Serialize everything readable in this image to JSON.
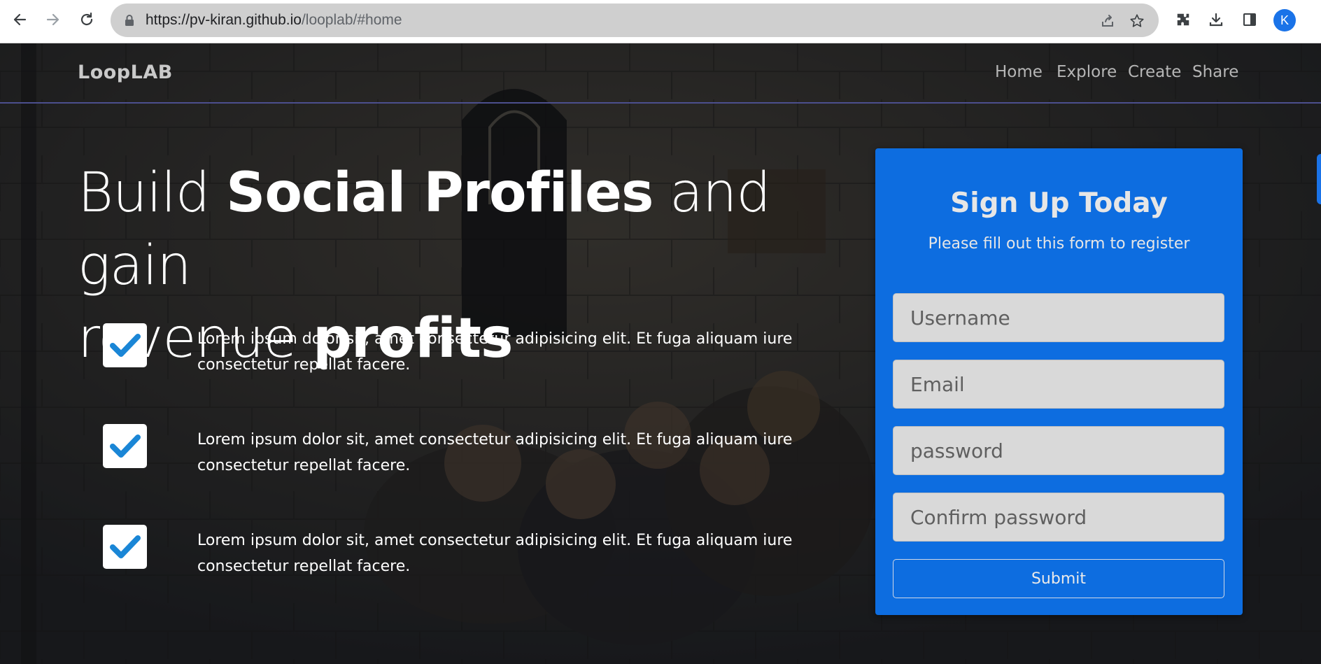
{
  "browser": {
    "url_host": "https://pv-kiran.github.io",
    "url_path": "/looplab/#home",
    "profile_initial": "K"
  },
  "nav": {
    "brand": "LoopLAB",
    "links": [
      "Home",
      "Explore",
      "Create",
      "Share"
    ]
  },
  "hero": {
    "headline": {
      "part1": "Build ",
      "bold1": "Social Profiles",
      "part2": " and gain",
      "part3": "revenue ",
      "bold2": "profits"
    },
    "features": [
      "Lorem ipsum dolor sit, amet consectetur adipisicing elit. Et fuga aliquam iure consectetur repellat facere.",
      "Lorem ipsum dolor sit, amet consectetur adipisicing elit. Et fuga aliquam iure consectetur repellat facere.",
      "Lorem ipsum dolor sit, amet consectetur adipisicing elit. Et fuga aliquam iure consectetur repellat facere."
    ]
  },
  "signup": {
    "title": "Sign Up Today",
    "subtitle": "Please fill out this form to register",
    "username_placeholder": "Username",
    "email_placeholder": "Email",
    "password_placeholder": "password",
    "confirm_placeholder": "Confirm password",
    "submit_label": "Submit"
  },
  "colors": {
    "card": "#0d6de0",
    "check": "#1a73e8",
    "nav_border": "#4c4f8e"
  }
}
